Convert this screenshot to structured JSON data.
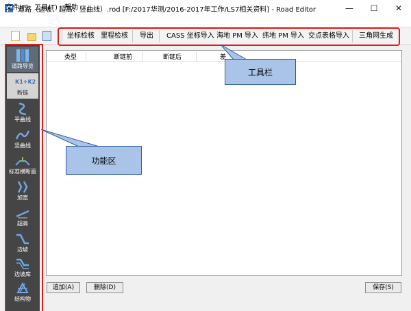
{
  "window": {
    "title": "道路（边坡、超高、竖曲线）.rod [F:/2017华测/2016-2017年工作/LS7相关资料] - Road Editor",
    "minimize": "—",
    "maximize": "☐",
    "close": "✕"
  },
  "menu": [
    "文件(F)",
    "工具(T)",
    "帮助"
  ],
  "toolbar": {
    "buttons": [
      "坐标检核",
      "里程检核",
      "导出",
      "CASS 坐标导入",
      "海地 PM 导入",
      "纬地 PM 导入",
      "交点表格导入",
      "三角网生成"
    ]
  },
  "sidebar": {
    "items": [
      {
        "label": "道路导览",
        "icon": "road-overview-icon"
      },
      {
        "label": "断链",
        "icon": "chain-break-icon",
        "badge": "K1+K2"
      },
      {
        "label": "平曲线",
        "icon": "horizontal-curve-icon"
      },
      {
        "label": "竖曲线",
        "icon": "vertical-curve-icon"
      },
      {
        "label": "标准横断面",
        "icon": "cross-section-icon"
      },
      {
        "label": "加宽",
        "icon": "widening-icon"
      },
      {
        "label": "超高",
        "icon": "superelevation-icon"
      },
      {
        "label": "边坡",
        "icon": "slope-icon"
      },
      {
        "label": "边坡库",
        "icon": "slope-library-icon"
      },
      {
        "label": "结构物",
        "icon": "structure-icon"
      }
    ]
  },
  "grid": {
    "columns": [
      "类型",
      "断链前",
      "断链后",
      "差"
    ]
  },
  "bottom": {
    "add": "追加(A)",
    "delete": "删除(D)",
    "save": "保存(S)"
  },
  "annotations": {
    "toolbar": "工具栏",
    "function_area": "功能区"
  },
  "colors": {
    "highlight": "#d92020",
    "callout_fill": "#a9c4e8",
    "callout_border": "#2e5d99",
    "sidebar_bg": "#454545"
  }
}
